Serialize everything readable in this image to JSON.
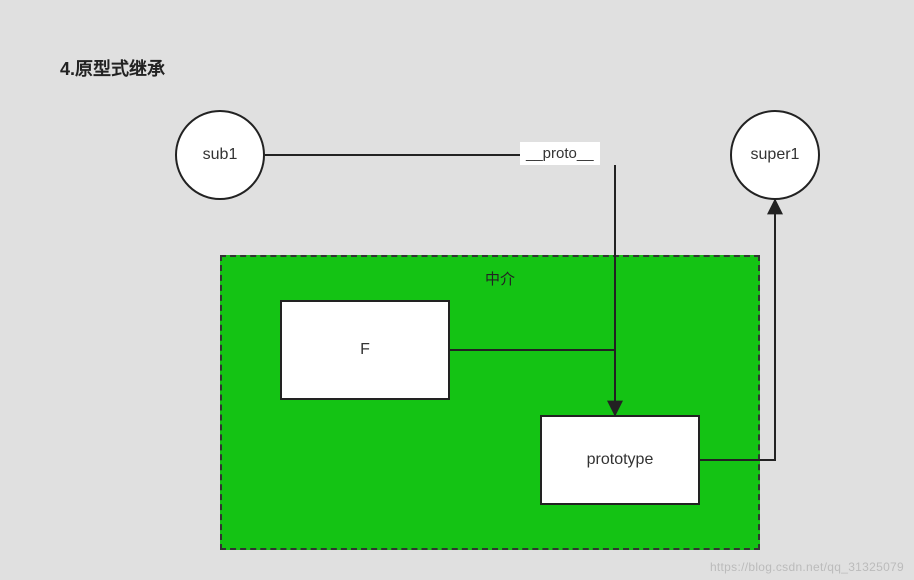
{
  "title": "4.原型式继承",
  "nodes": {
    "sub1": "sub1",
    "super1": "super1",
    "proto_label": "__proto__",
    "mediator_title": "中介",
    "f_label": "F",
    "prototype_label": "prototype"
  },
  "watermark": "https://blog.csdn.net/qq_31325079",
  "chart_data": {
    "type": "diagram",
    "title": "4.原型式继承 (Prototypal Inheritance)",
    "nodes": [
      {
        "id": "sub1",
        "label": "sub1",
        "shape": "circle"
      },
      {
        "id": "super1",
        "label": "super1",
        "shape": "circle"
      },
      {
        "id": "F",
        "label": "F",
        "shape": "rect",
        "group": "中介"
      },
      {
        "id": "prototype",
        "label": "prototype",
        "shape": "rect",
        "group": "中介"
      }
    ],
    "groups": [
      {
        "id": "mediator",
        "label": "中介",
        "members": [
          "F",
          "prototype"
        ],
        "style": "green-dashed"
      }
    ],
    "edges": [
      {
        "from": "sub1",
        "to": "prototype",
        "label": "__proto__",
        "arrow": true
      },
      {
        "from": "F",
        "to": "prototype",
        "label": "",
        "arrow": true
      },
      {
        "from": "prototype",
        "to": "super1",
        "label": "",
        "arrow": true
      }
    ]
  }
}
